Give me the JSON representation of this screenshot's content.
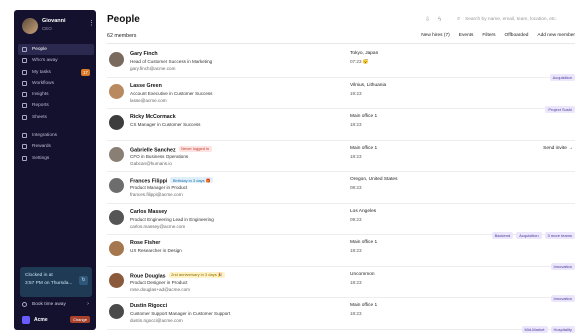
{
  "sidebar": {
    "user": {
      "name": "Giovanni",
      "role": "CEO"
    },
    "items": [
      {
        "label": "People",
        "icon": "person-icon",
        "active": true,
        "badge": ""
      },
      {
        "label": "Who's away",
        "icon": "plane-icon",
        "active": false,
        "badge": ""
      },
      {
        "label": "My tasks",
        "icon": "checklist-icon",
        "active": false,
        "badge": "17"
      },
      {
        "label": "Workflows",
        "icon": "workflow-icon",
        "active": false,
        "badge": ""
      },
      {
        "label": "Insights",
        "icon": "chart-icon",
        "active": false,
        "badge": ""
      },
      {
        "label": "Reports",
        "icon": "report-icon",
        "active": false,
        "badge": ""
      },
      {
        "label": "Sheets",
        "icon": "sheet-icon",
        "active": false,
        "badge": ""
      },
      {
        "label": "Integrations",
        "icon": "plug-icon",
        "active": false,
        "badge": ""
      },
      {
        "label": "Rewards",
        "icon": "gift-icon",
        "active": false,
        "badge": ""
      },
      {
        "label": "Settings",
        "icon": "gear-icon",
        "active": false,
        "badge": ""
      }
    ],
    "clock": {
      "line1": "Clocked in at",
      "line2": "3:57 PM on Thursda...",
      "btn": "↻"
    },
    "time_away": "Book time away",
    "org": {
      "name": "Acme",
      "tag": "Change"
    }
  },
  "main": {
    "title": "People",
    "search_placeholder": "Search by name, email, team, location, etc.",
    "members_count": "62 members",
    "actions": [
      "New hires (7)",
      "Events",
      "Filters",
      "Offboarded",
      "Add new member"
    ],
    "rows": [
      {
        "name": "Gary Finch",
        "pill": "",
        "pill_type": "",
        "role": "Head of Customer Success in Marketing",
        "email": "gary.finch@acme.com",
        "location": "Tokyo, Japan",
        "time": "07:23 😴",
        "tags": [
          "Acquisition"
        ],
        "extra": ""
      },
      {
        "name": "Lasse Green",
        "pill": "",
        "pill_type": "",
        "role": "Account Executive in Customer Success",
        "email": "lasse@acme.com",
        "location": "Vilnius, Lithuania",
        "time": "19:23",
        "tags": [
          "Project Sushi"
        ],
        "extra": ""
      },
      {
        "name": "Ricky McCormack",
        "pill": "",
        "pill_type": "",
        "role": "CS Manager in Customer Success",
        "email": "",
        "location": "Main office 1",
        "time": "18:23",
        "tags": [],
        "extra": ""
      },
      {
        "name": "Gabrielle Sanchez",
        "pill": "Never logged in",
        "pill_type": "red",
        "role": "CFO in Business Operations",
        "email": "Gabcan@humans.io",
        "location": "Main office 1",
        "time": "18:23",
        "tags": [],
        "extra": "Send invite →"
      },
      {
        "name": "Frances Filippi",
        "pill": "Birthday in 3 days 🎁",
        "pill_type": "blue",
        "role": "Product Manager in Product",
        "email": "frances.filippi@acme.com",
        "location": "Oregon, United States",
        "time": "08:23",
        "tags": [],
        "extra": ""
      },
      {
        "name": "Carlos Massey",
        "pill": "",
        "pill_type": "",
        "role": "Product Engineering Lead in Engineering",
        "email": "carlos.massey@acme.com",
        "location": "Los Angeles",
        "time": "09:23",
        "tags": [
          "Backend",
          "Acquisition",
          "3 more teams"
        ],
        "extra": ""
      },
      {
        "name": "Rose Fisher",
        "pill": "",
        "pill_type": "",
        "role": "UX Researcher in Design",
        "email": "",
        "location": "Main office 1",
        "time": "18:23",
        "tags": [
          "Innovation"
        ],
        "extra": ""
      },
      {
        "name": "Roue Douglas",
        "pill": "2nd anniversary in 3 days 🎉",
        "pill_type": "yellow",
        "role": "Product Designer in Product",
        "email": "rose.douglas+ad@acme.com",
        "location": "Uncommon",
        "time": "18:23",
        "tags": [
          "Innovation"
        ],
        "extra": ""
      },
      {
        "name": "Dustin Rigocci",
        "pill": "",
        "pill_type": "",
        "role": "Customer Support Manager in Customer Support",
        "email": "dustin.rigocci@acme.com",
        "location": "Main office 1",
        "time": "18:23",
        "tags": [
          "Mid-Market",
          "Hospitality"
        ],
        "extra": ""
      }
    ]
  }
}
